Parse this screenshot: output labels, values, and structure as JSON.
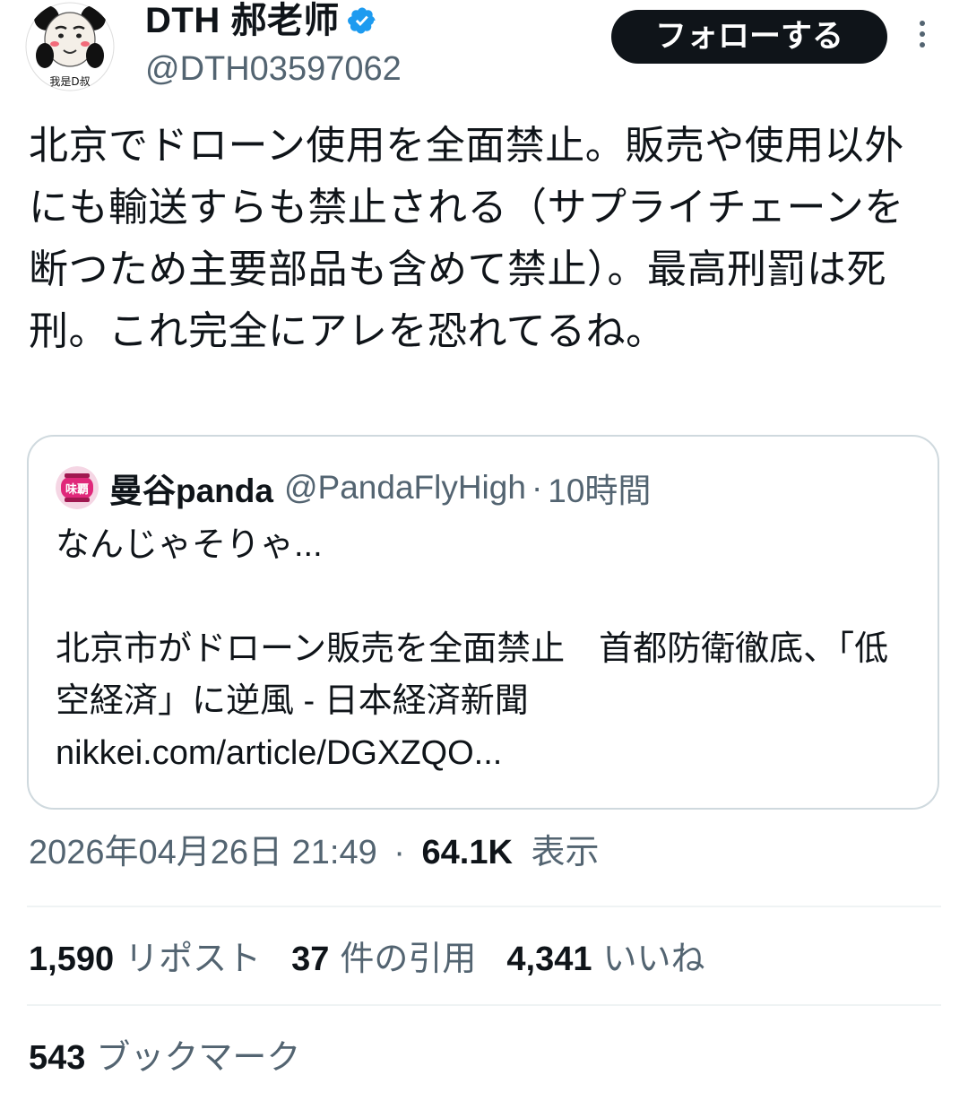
{
  "author": {
    "display_name": "DTH 郝老师",
    "handle": "@DTH03597062",
    "avatar_caption": "我是D叔",
    "verified_icon": "verified-badge-icon"
  },
  "header": {
    "follow_label": "フォローする",
    "more_icon": "more-vertical-icon"
  },
  "tweet": {
    "text": "北京でドローン使用を全面禁止。販売や使用以外にも輸送すらも禁止される（サプライチェーンを断つため主要部品も含めて禁止）。最高刑罰は死刑。これ完全にアレを恐れてるね。"
  },
  "quote": {
    "avatar_text": "味覇",
    "name": "曼谷panda",
    "handle": "@PandaFlyHigh",
    "separator": "·",
    "time": "10時間",
    "text": "なんじゃそりゃ...\n\n北京市がドローン販売を全面禁止　首都防衛徹底、「低空経済」に逆風 - 日本経済新聞\nnikkei.com/article/DGXZQO..."
  },
  "meta": {
    "timestamp": "2026年04月26日 21:49",
    "separator": "·",
    "views_count": "64.1K",
    "views_label": "表示"
  },
  "stats": {
    "reposts_count": "1,590",
    "reposts_label": "リポスト",
    "quotes_count": "37",
    "quotes_label": "件の引用",
    "likes_count": "4,341",
    "likes_label": "いいね",
    "bookmarks_count": "543",
    "bookmarks_label": "ブックマーク"
  },
  "colors": {
    "primary_text": "#0f1419",
    "secondary_text": "#536471",
    "verified_blue": "#1d9bf0",
    "border": "#cfd9de",
    "divider": "#eff3f4"
  }
}
